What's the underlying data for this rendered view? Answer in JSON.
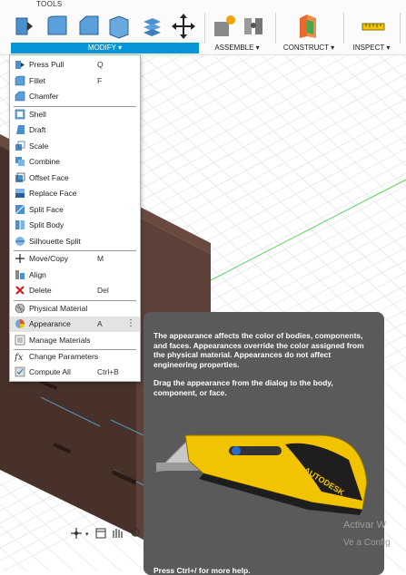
{
  "toolbar": {
    "tools_caption": "TOOLS",
    "groups": {
      "modify": "MODIFY ▾",
      "assemble": "ASSEMBLE ▾",
      "construct": "CONSTRUCT ▾",
      "inspect": "INSPECT ▾"
    }
  },
  "menu": {
    "items": [
      {
        "label": "Press Pull",
        "shortcut": "Q"
      },
      {
        "label": "Fillet",
        "shortcut": "F"
      },
      {
        "label": "Chamfer",
        "shortcut": ""
      },
      {
        "label": "Shell",
        "shortcut": ""
      },
      {
        "label": "Draft",
        "shortcut": ""
      },
      {
        "label": "Scale",
        "shortcut": ""
      },
      {
        "label": "Combine",
        "shortcut": ""
      },
      {
        "label": "Offset Face",
        "shortcut": ""
      },
      {
        "label": "Replace Face",
        "shortcut": ""
      },
      {
        "label": "Split Face",
        "shortcut": ""
      },
      {
        "label": "Split Body",
        "shortcut": ""
      },
      {
        "label": "Silhouette Split",
        "shortcut": ""
      },
      {
        "label": "Move/Copy",
        "shortcut": "M"
      },
      {
        "label": "Align",
        "shortcut": ""
      },
      {
        "label": "Delete",
        "shortcut": "Del"
      },
      {
        "label": "Physical Material",
        "shortcut": ""
      },
      {
        "label": "Appearance",
        "shortcut": "A"
      },
      {
        "label": "Manage Materials",
        "shortcut": ""
      },
      {
        "label": "Change Parameters",
        "shortcut": ""
      },
      {
        "label": "Compute All",
        "shortcut": "Ctrl+B"
      }
    ],
    "more_glyph": "⋮"
  },
  "tooltip": {
    "description": "The appearance affects the color of bodies, components, and faces. Appearances override the color assigned from the physical material. Appearances do not affect engineering properties.",
    "instruction": "Drag the appearance from the dialog to the body, component, or face.",
    "hint": "Press Ctrl+/ for more help.",
    "brand_text": "AUTODESK"
  },
  "watermark": {
    "line1": "Activar W",
    "line2": "Ve a Config"
  },
  "colors": {
    "accent": "#0696d7",
    "body": "#4a3630",
    "tooltip_bg": "#5a5a5a",
    "knife_yellow": "#f2c300"
  }
}
